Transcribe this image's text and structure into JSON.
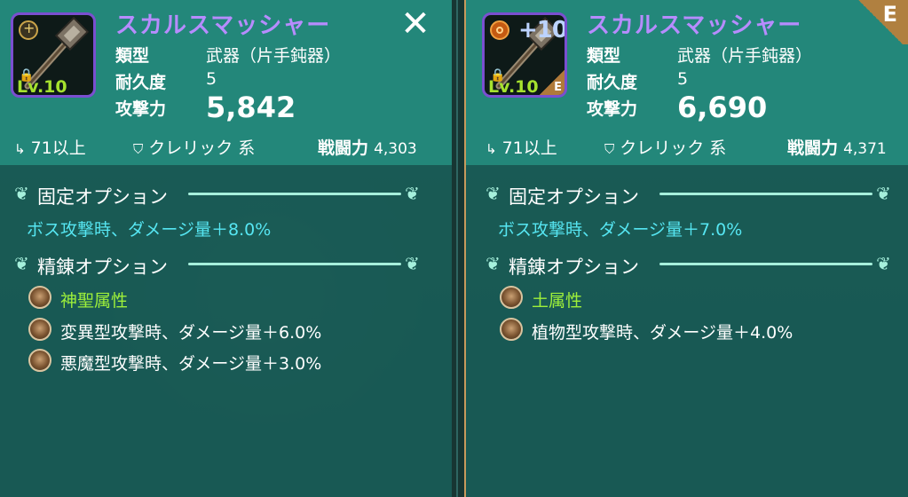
{
  "left": {
    "item_name": "スカルスマッシャー",
    "icon": {
      "level": "Lv.10",
      "enhance": "",
      "grade": ""
    },
    "stats": [
      {
        "label": "類型",
        "value": "武器（片手鈍器）"
      },
      {
        "label": "耐久度",
        "value": "5"
      },
      {
        "label": "攻撃力",
        "value": "5,842"
      }
    ],
    "req_level": "71以上",
    "req_class": "クレリック 系",
    "power_label": "戦闘力",
    "power_value": "4,303",
    "fixed_title": "固定オプション",
    "fixed_options": [
      "ボス攻撃時、ダメージ量＋8.0%"
    ],
    "refine_title": "精錬オプション",
    "refine_options": [
      "神聖属性",
      "変異型攻撃時、ダメージ量＋6.0%",
      "悪魔型攻撃時、ダメージ量＋3.0%"
    ],
    "close_icon": "✕"
  },
  "right": {
    "item_name": "スカルスマッシャー",
    "grade_tag": "E",
    "icon": {
      "level": "Lv.10",
      "enhance": "+10",
      "grade": "E"
    },
    "stats": [
      {
        "label": "類型",
        "value": "武器（片手鈍器）"
      },
      {
        "label": "耐久度",
        "value": "5"
      },
      {
        "label": "攻撃力",
        "value": "6,690"
      }
    ],
    "req_level": "71以上",
    "req_class": "クレリック 系",
    "power_label": "戦闘力",
    "power_value": "4,371",
    "fixed_title": "固定オプション",
    "fixed_options": [
      "ボス攻撃時、ダメージ量＋7.0%"
    ],
    "refine_title": "精錬オプション",
    "refine_options": [
      "土属性",
      "植物型攻撃時、ダメージ量＋4.0%"
    ]
  },
  "colors": {
    "name": "#b78cff",
    "fixed_option": "#56e6f2",
    "element_option": "#9ef03a",
    "header_bg": "#23877a",
    "icon_border": "#7a4fd0"
  }
}
